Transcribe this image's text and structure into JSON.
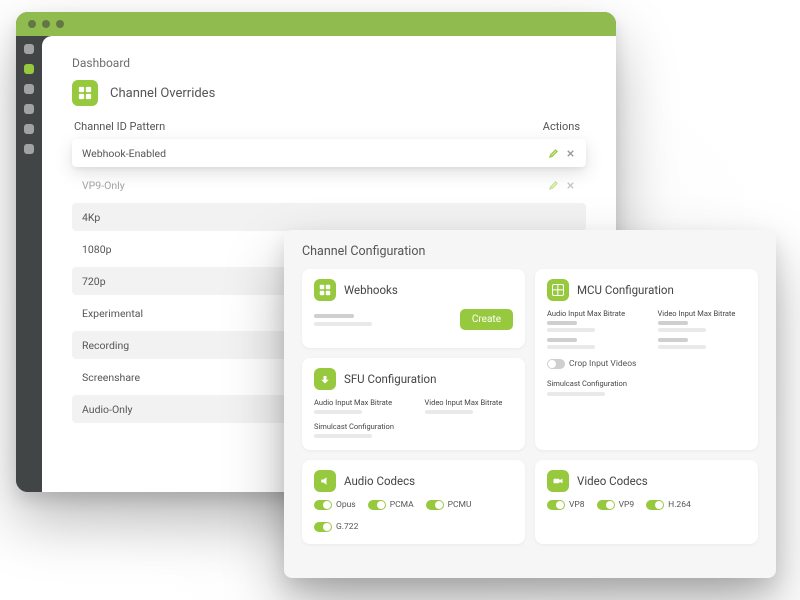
{
  "dashboard": {
    "crumb": "Dashboard",
    "section_title": "Channel Overrides",
    "col_pattern": "Channel ID Pattern",
    "col_actions": "Actions",
    "rows": [
      {
        "label": "Webhook-Enabled"
      },
      {
        "label": "VP9-Only"
      },
      {
        "label": "4Kp"
      },
      {
        "label": "1080p"
      },
      {
        "label": "720p"
      },
      {
        "label": "Experimental"
      },
      {
        "label": "Recording"
      },
      {
        "label": "Screenshare"
      },
      {
        "label": "Audio-Only"
      }
    ]
  },
  "panel": {
    "title": "Channel Configuration",
    "webhooks": {
      "title": "Webhooks",
      "create": "Create"
    },
    "mcu": {
      "title": "MCU Configuration",
      "audio": "Audio Input Max Bitrate",
      "video": "Video Input Max Bitrate",
      "crop": "Crop Input Videos",
      "simulcast": "Simulcast Configuration"
    },
    "sfu": {
      "title": "SFU Configuration",
      "audio": "Audio Input Max Bitrate",
      "video": "Video Input Max Bitrate",
      "simulcast": "Simulcast Configuration"
    },
    "audio_codecs": {
      "title": "Audio Codecs",
      "items": [
        "Opus",
        "PCMA",
        "PCMU",
        "G.722"
      ]
    },
    "video_codecs": {
      "title": "Video Codecs",
      "items": [
        "VP8",
        "VP9",
        "H.264"
      ]
    }
  },
  "colors": {
    "accent": "#96c93d"
  }
}
